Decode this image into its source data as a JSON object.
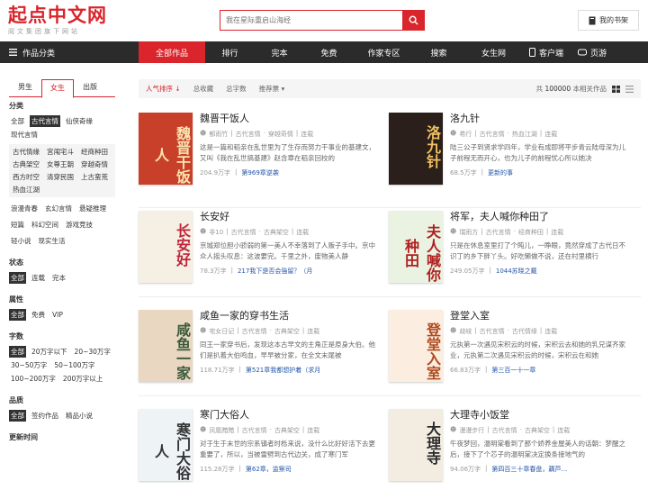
{
  "header": {
    "logo": "起点中文网",
    "logo_sub": "阅文集团旗下网站",
    "search_placeholder": "我在星际重启山海经",
    "shelf_label": "我的书架"
  },
  "nav": {
    "category_label": "作品分类",
    "items": [
      "全部作品",
      "排行",
      "完本",
      "免费",
      "作家专区",
      "搜索",
      "女生网"
    ],
    "client_label": "客户端",
    "game_label": "页游"
  },
  "sidebar": {
    "gender_tabs": [
      "男生",
      "女生",
      "出版"
    ],
    "category_title": "分类",
    "top_tags": [
      "全部",
      "古代言情",
      "仙侠奇缘",
      "现代言情"
    ],
    "sub_tags": [
      "古代情缘",
      "宫闱宅斗",
      "经商种田",
      "古典架空",
      "女尊王朝",
      "穿越奇情",
      "西方时空",
      "清穿民国",
      "上古蛮荒",
      "热血江湖"
    ],
    "more_tags": [
      "浪漫青春",
      "玄幻言情",
      "悬疑推理",
      "短篇",
      "科幻空间",
      "游戏竞技",
      "轻小说",
      "现实生活"
    ],
    "status_title": "状态",
    "status_tags": [
      "全部",
      "连载",
      "完本"
    ],
    "attr_title": "属性",
    "attr_tags": [
      "全部",
      "免费",
      "VIP"
    ],
    "words_title": "字数",
    "words_tags": [
      "全部",
      "20万字以下",
      "20~30万字",
      "30~50万字",
      "50~100万字",
      "100~200万字",
      "200万字以上"
    ],
    "quality_title": "品质",
    "quality_tags": [
      "全部",
      "签约作品",
      "精品小说"
    ],
    "time_title": "更新时间"
  },
  "sortbar": {
    "items": [
      "人气排序 ↓",
      "总收藏",
      "总字数",
      "推荐票 ▾"
    ],
    "count_text": "100000",
    "count_suffix": "本相关作品"
  },
  "books": [
    {
      "title": "魏晋干饭人",
      "author": "郁雨竹",
      "cat": "古代言情",
      "sub": "穿越奇情",
      "status": "连载",
      "desc": "这是一篇和稻亲在乱世里为了生存而努力干事业的基建文，又叫《我在乱世搞基建》赵含章在稻亲回校的",
      "words": "204.9万字",
      "update": "第969章逆袭",
      "cover_text": "魏晋干饭人",
      "bg": "#c8402a",
      "fg": "#fbe3b0"
    },
    {
      "title": "洛九针",
      "author": "希行",
      "cat": "古代言情",
      "sub": "热血江湖",
      "status": "连载",
      "desc": "陆三公子到贤求学四年，学业有成即将平步青云陆母深为儿子前程无而开心，也为儿子的前程忧心所以她决",
      "words": "68.5万字",
      "update": "更新的事",
      "cover_text": "洛九针",
      "bg": "#2a1f1a",
      "fg": "#f0c060"
    },
    {
      "title": "长安好",
      "author": "非10",
      "cat": "古代言情",
      "sub": "古典架空",
      "status": "连载",
      "desc": "京城郑位胆小骄弱的第一美人不幸落到了人贩子手中。京中众人摇头叹息：这波要完。千里之外，废物美人静",
      "words": "78.3万字",
      "update": "217我下是否会強留？（月",
      "cover_text": "长安好",
      "bg": "#f6efe4",
      "fg": "#c0243a"
    },
    {
      "title": "将军，夫人喊你种田了",
      "author": "瑞雨方",
      "cat": "古代言情",
      "sub": "经商种田",
      "status": "连载",
      "desc": "只是在休息室里打了个盹儿，一睁眼，竟然穿成了古代日不识丁的乡下胖丫头。好吃懒做不说，还在村里横行",
      "words": "249.05万字",
      "update": "1044苏晓之戴",
      "cover_text": "夫人喊你种田",
      "bg": "#eaf2e2",
      "fg": "#b02020"
    },
    {
      "title": "咸鱼一家的穿书生活",
      "author": "宅女日记",
      "cat": "古代言情",
      "sub": "古典架空",
      "status": "连载",
      "desc": "同王一家穿书后，发现这本古早文的主角正是原身大伯。他们是扒着大伯鸣血，早早被分家，在全文末尾被",
      "words": "118.71万字",
      "update": "第521章我都想护着（求月",
      "cover_text": "咸鱼一家",
      "bg": "#e9d7c2",
      "fg": "#3a5a3a"
    },
    {
      "title": "登堂入室",
      "author": "歧岐",
      "cat": "古代言情",
      "sub": "古代情缘",
      "status": "连载",
      "desc": "元执第一次遇见宋积云的时候，宋积云去和她的乳兄谋齐家业，元执第二次遇见宋积云的时候，宋积云在和她",
      "words": "66.83万字",
      "update": "第三百一十一章",
      "cover_text": "登堂入室",
      "bg": "#fbeee0",
      "fg": "#b04a20"
    },
    {
      "title": "寒门大俗人",
      "author": "凤凰黯黯",
      "cat": "古代言情",
      "sub": "古典架空",
      "status": "连载",
      "desc": "对于生于末世的宗系镇者时栎来说，没什么比好好活下去更重要了，所以，当被雷劈到古代边关，成了寒门军",
      "words": "115.28万字",
      "update": "第62章，监察司",
      "cover_text": "寒门大俗人",
      "bg": "#eef3f6",
      "fg": "#333333"
    },
    {
      "title": "大理寺小饭堂",
      "author": "漫漫步行",
      "cat": "古代言情",
      "sub": "古典架空",
      "status": "连载",
      "desc": "午夜梦回，温明棠看到了那个娇养金屋美人的话朝：梦醒之后，接下了个芯子的温明棠决定换条接地气的",
      "words": "94.06万字",
      "update": "第四百三十章春盘，藕芦…",
      "cover_text": "大理寺",
      "bg": "#f3ede1",
      "fg": "#2a2a2a"
    }
  ],
  "colors": {
    "accent": "#d9252b",
    "nav_bg": "#2b2b2b"
  }
}
